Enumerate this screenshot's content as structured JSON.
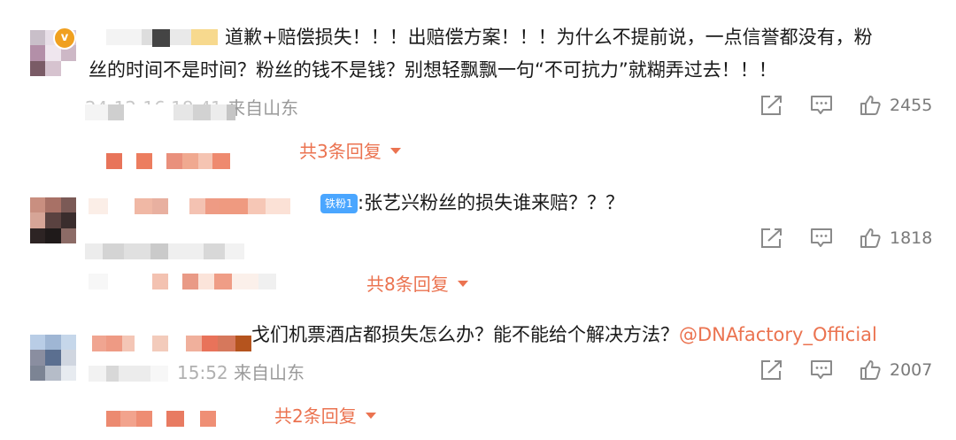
{
  "comments": [
    {
      "text_line1": "道歉+赔偿损失！！！出赔偿方案！！！为什么不提前说，一点信誉都没有，粉",
      "text_line2": "丝的时间不是时间？粉丝的钱不是钱？别想轻飘飘一句“不可抗力”就糊弄过去！！！",
      "meta_time_fragment": "24-12-16 18:41",
      "meta_location": "来自山东",
      "likes": "2455",
      "replies_label": "共3条回复",
      "avatar_badge": "v"
    },
    {
      "fan_badge": "铁粉1",
      "text_line1": ":张艺兴粉丝的损失谁来赔？？？",
      "likes": "1818",
      "replies_label": "共8条回复"
    },
    {
      "text_prefix": "戈们机票酒店都损失怎么办？能不能给个解决方法？",
      "mention": "@DNAfactory_Official",
      "meta_time_fragment": "15:52",
      "meta_location": "来自山东",
      "likes": "2007",
      "replies_label": "共2条回复"
    }
  ],
  "icons": {
    "share": "share-icon",
    "comment": "comment-icon",
    "like": "like-icon"
  },
  "colors": {
    "accent": "#eb7350",
    "meta": "#9a9a9a",
    "text": "#1a1a1a",
    "fan_badge": "#4aa6ff"
  }
}
